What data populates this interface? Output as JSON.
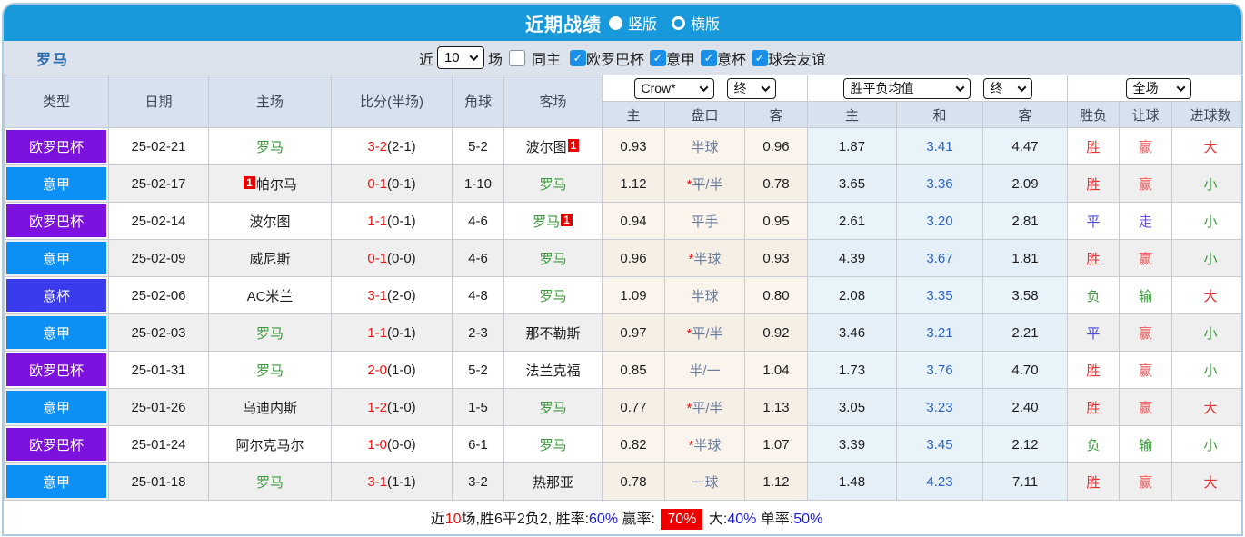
{
  "titlebar": {
    "title": "近期战绩",
    "layout_options": [
      {
        "label": "竖版",
        "selected": true
      },
      {
        "label": "横版",
        "selected": false
      }
    ]
  },
  "filterbar": {
    "team": "罗马",
    "near_label": "近",
    "count_value": "10",
    "games_label": "场",
    "same_home": {
      "label": "同主",
      "checked": false
    },
    "league_filters": [
      {
        "label": "欧罗巴杯",
        "checked": true
      },
      {
        "label": "意甲",
        "checked": true
      },
      {
        "label": "意杯",
        "checked": true
      },
      {
        "label": "球会友谊",
        "checked": true
      }
    ]
  },
  "table": {
    "main_headers": [
      "类型",
      "日期",
      "主场",
      "比分(半场)",
      "角球",
      "客场"
    ],
    "selects": {
      "bookmaker": "Crow*",
      "bookmaker_stage": "终",
      "average": "胜平负均值",
      "average_stage": "终",
      "scope": "全场"
    },
    "sub_headers": [
      "主",
      "盘口",
      "客",
      "主",
      "和",
      "客",
      "胜负",
      "让球",
      "进球数"
    ],
    "rows": [
      {
        "league": "欧罗巴杯",
        "leagueClass": "europa",
        "date": "25-02-21",
        "home": {
          "name": "罗马",
          "green": true,
          "badge": null
        },
        "score": "3-2",
        "half": "(2-1)",
        "corner": "5-2",
        "away": {
          "name": "波尔图",
          "green": false,
          "badge": "after"
        },
        "crow": {
          "home": "0.93",
          "star": false,
          "handicap": "半球",
          "away": "0.96"
        },
        "avg": {
          "home": "1.87",
          "draw": "3.41",
          "away": "4.47"
        },
        "result": {
          "text": "胜",
          "cls": "win"
        },
        "let_result": {
          "text": "赢",
          "cls": "hwin"
        },
        "goals": {
          "text": "大",
          "cls": "big"
        }
      },
      {
        "league": "意甲",
        "leagueClass": "seriea",
        "date": "25-02-17",
        "home": {
          "name": "帕尔马",
          "green": false,
          "badge": "before"
        },
        "score": "0-1",
        "half": "(0-1)",
        "corner": "1-10",
        "away": {
          "name": "罗马",
          "green": true,
          "badge": null
        },
        "crow": {
          "home": "1.12",
          "star": true,
          "handicap": "平/半",
          "away": "0.78"
        },
        "avg": {
          "home": "3.65",
          "draw": "3.36",
          "away": "2.09"
        },
        "result": {
          "text": "胜",
          "cls": "win"
        },
        "let_result": {
          "text": "赢",
          "cls": "hwin"
        },
        "goals": {
          "text": "小",
          "cls": "small"
        }
      },
      {
        "league": "欧罗巴杯",
        "leagueClass": "europa",
        "date": "25-02-14",
        "home": {
          "name": "波尔图",
          "green": false,
          "badge": null
        },
        "score": "1-1",
        "half": "(0-1)",
        "corner": "4-6",
        "away": {
          "name": "罗马",
          "green": true,
          "badge": "after"
        },
        "crow": {
          "home": "0.94",
          "star": false,
          "handicap": "平手",
          "away": "0.95"
        },
        "avg": {
          "home": "2.61",
          "draw": "3.20",
          "away": "2.81"
        },
        "result": {
          "text": "平",
          "cls": "draw"
        },
        "let_result": {
          "text": "走",
          "cls": "hwalk"
        },
        "goals": {
          "text": "小",
          "cls": "small"
        }
      },
      {
        "league": "意甲",
        "leagueClass": "seriea",
        "date": "25-02-09",
        "home": {
          "name": "威尼斯",
          "green": false,
          "badge": null
        },
        "score": "0-1",
        "half": "(0-0)",
        "corner": "4-6",
        "away": {
          "name": "罗马",
          "green": true,
          "badge": null
        },
        "crow": {
          "home": "0.96",
          "star": true,
          "handicap": "半球",
          "away": "0.93"
        },
        "avg": {
          "home": "4.39",
          "draw": "3.67",
          "away": "1.81"
        },
        "result": {
          "text": "胜",
          "cls": "win"
        },
        "let_result": {
          "text": "赢",
          "cls": "hwin"
        },
        "goals": {
          "text": "小",
          "cls": "small"
        }
      },
      {
        "league": "意杯",
        "leagueClass": "coppa",
        "date": "25-02-06",
        "home": {
          "name": "AC米兰",
          "green": false,
          "badge": null
        },
        "score": "3-1",
        "half": "(2-0)",
        "corner": "4-8",
        "away": {
          "name": "罗马",
          "green": true,
          "badge": null
        },
        "crow": {
          "home": "1.09",
          "star": false,
          "handicap": "半球",
          "away": "0.80"
        },
        "avg": {
          "home": "2.08",
          "draw": "3.35",
          "away": "3.58"
        },
        "result": {
          "text": "负",
          "cls": "lose"
        },
        "let_result": {
          "text": "输",
          "cls": "hlose"
        },
        "goals": {
          "text": "大",
          "cls": "big"
        }
      },
      {
        "league": "意甲",
        "leagueClass": "seriea",
        "date": "25-02-03",
        "home": {
          "name": "罗马",
          "green": true,
          "badge": null
        },
        "score": "1-1",
        "half": "(0-1)",
        "corner": "2-3",
        "away": {
          "name": "那不勒斯",
          "green": false,
          "badge": null
        },
        "crow": {
          "home": "0.97",
          "star": true,
          "handicap": "平/半",
          "away": "0.92"
        },
        "avg": {
          "home": "3.46",
          "draw": "3.21",
          "away": "2.21"
        },
        "result": {
          "text": "平",
          "cls": "draw"
        },
        "let_result": {
          "text": "赢",
          "cls": "hwin"
        },
        "goals": {
          "text": "小",
          "cls": "small"
        }
      },
      {
        "league": "欧罗巴杯",
        "leagueClass": "europa",
        "date": "25-01-31",
        "home": {
          "name": "罗马",
          "green": true,
          "badge": null
        },
        "score": "2-0",
        "half": "(1-0)",
        "corner": "5-2",
        "away": {
          "name": "法兰克福",
          "green": false,
          "badge": null
        },
        "crow": {
          "home": "0.85",
          "star": false,
          "handicap": "半/一",
          "away": "1.04"
        },
        "avg": {
          "home": "1.73",
          "draw": "3.76",
          "away": "4.70"
        },
        "result": {
          "text": "胜",
          "cls": "win"
        },
        "let_result": {
          "text": "赢",
          "cls": "hwin"
        },
        "goals": {
          "text": "小",
          "cls": "small"
        }
      },
      {
        "league": "意甲",
        "leagueClass": "seriea",
        "date": "25-01-26",
        "home": {
          "name": "乌迪内斯",
          "green": false,
          "badge": null
        },
        "score": "1-2",
        "half": "(1-0)",
        "corner": "1-5",
        "away": {
          "name": "罗马",
          "green": true,
          "badge": null
        },
        "crow": {
          "home": "0.77",
          "star": true,
          "handicap": "平/半",
          "away": "1.13"
        },
        "avg": {
          "home": "3.05",
          "draw": "3.23",
          "away": "2.40"
        },
        "result": {
          "text": "胜",
          "cls": "win"
        },
        "let_result": {
          "text": "赢",
          "cls": "hwin"
        },
        "goals": {
          "text": "大",
          "cls": "big"
        }
      },
      {
        "league": "欧罗巴杯",
        "leagueClass": "europa",
        "date": "25-01-24",
        "home": {
          "name": "阿尔克马尔",
          "green": false,
          "badge": null
        },
        "score": "1-0",
        "half": "(0-0)",
        "corner": "6-1",
        "away": {
          "name": "罗马",
          "green": true,
          "badge": null
        },
        "crow": {
          "home": "0.82",
          "star": true,
          "handicap": "半球",
          "away": "1.07"
        },
        "avg": {
          "home": "3.39",
          "draw": "3.45",
          "away": "2.12"
        },
        "result": {
          "text": "负",
          "cls": "lose"
        },
        "let_result": {
          "text": "输",
          "cls": "hlose"
        },
        "goals": {
          "text": "小",
          "cls": "small"
        }
      },
      {
        "league": "意甲",
        "leagueClass": "seriea",
        "date": "25-01-18",
        "home": {
          "name": "罗马",
          "green": true,
          "badge": null
        },
        "score": "3-1",
        "half": "(1-1)",
        "corner": "3-2",
        "away": {
          "name": "热那亚",
          "green": false,
          "badge": null
        },
        "crow": {
          "home": "0.78",
          "star": false,
          "handicap": "一球",
          "away": "1.12"
        },
        "avg": {
          "home": "1.48",
          "draw": "4.23",
          "away": "7.11"
        },
        "result": {
          "text": "胜",
          "cls": "win"
        },
        "let_result": {
          "text": "赢",
          "cls": "hwin"
        },
        "goals": {
          "text": "大",
          "cls": "big"
        }
      }
    ]
  },
  "footer": {
    "segments": [
      {
        "text": "近",
        "cls": "fk"
      },
      {
        "text": "10",
        "cls": "fred"
      },
      {
        "text": "场,胜6平2负2, 胜率:",
        "cls": "fk"
      },
      {
        "text": "60%",
        "cls": "fblue"
      },
      {
        "text": " 赢率: ",
        "cls": "fk"
      },
      {
        "text": "70%",
        "cls": "fbox"
      },
      {
        "text": " 大:",
        "cls": "fk"
      },
      {
        "text": "40%",
        "cls": "fblue"
      },
      {
        "text": " 单率:",
        "cls": "fk"
      },
      {
        "text": "50%",
        "cls": "fblue"
      }
    ]
  },
  "colors": {
    "titlebar_blue": "#1899dc",
    "checkbox_blue": "#1a8fe8",
    "europa_purple": "#7d11dd",
    "serie_a_blue": "#0d90f5",
    "coppa_blue": "#3b3bee",
    "win_red": "#e62e2e",
    "draw_blue": "#4b4bdd",
    "lose_green": "#3a9a3a",
    "badge_red": "#e80000",
    "rate_blue": "#1919e6"
  }
}
